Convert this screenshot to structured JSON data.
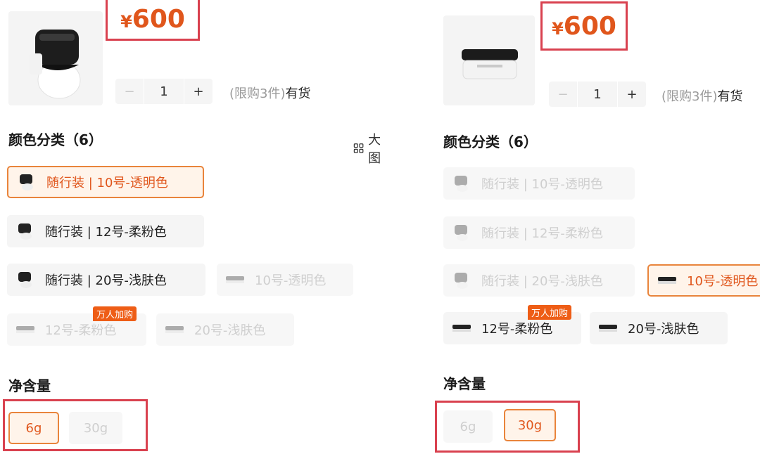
{
  "left": {
    "price_symbol": "¥",
    "price_value": "600",
    "quantity": "1",
    "stepper_minus": "−",
    "stepper_plus": "+",
    "limit_text": "(限购3件)",
    "stock_text": "有货",
    "color_title": "颜色分类（6）",
    "big_view_label": "大图",
    "options": [
      {
        "label": "随行装 | 10号-透明色",
        "state": "selected"
      },
      {
        "label": "随行装 | 12号-柔粉色",
        "state": "normal"
      },
      {
        "label": "随行装 | 20号-浅肤色",
        "state": "normal"
      },
      {
        "label": "10号-透明色",
        "state": "disabled"
      },
      {
        "label": "12号-柔粉色",
        "state": "disabled"
      },
      {
        "label": "20号-浅肤色",
        "state": "disabled"
      }
    ],
    "badge": "万人加购",
    "size_title": "净含量",
    "sizes": [
      {
        "label": "6g",
        "state": "selected"
      },
      {
        "label": "30g",
        "state": "disabled"
      }
    ]
  },
  "right": {
    "price_symbol": "¥",
    "price_value": "600",
    "quantity": "1",
    "stepper_minus": "−",
    "stepper_plus": "+",
    "limit_text": "(限购3件)",
    "stock_text": "有货",
    "color_title": "颜色分类（6）",
    "options": [
      {
        "label": "随行装 | 10号-透明色",
        "state": "disabled"
      },
      {
        "label": "随行装 | 12号-柔粉色",
        "state": "disabled"
      },
      {
        "label": "随行装 | 20号-浅肤色",
        "state": "disabled"
      },
      {
        "label": "10号-透明色",
        "state": "selected"
      },
      {
        "label": "12号-柔粉色",
        "state": "normal"
      },
      {
        "label": "20号-浅肤色",
        "state": "normal"
      }
    ],
    "badge": "万人加购",
    "size_title": "净含量",
    "sizes": [
      {
        "label": "6g",
        "state": "disabled"
      },
      {
        "label": "30g",
        "state": "selected"
      }
    ]
  },
  "colors": {
    "accent": "#e0561c",
    "highlight_box": "#d9414f",
    "selected_border": "#e9843b",
    "badge": "#ee5d16"
  }
}
